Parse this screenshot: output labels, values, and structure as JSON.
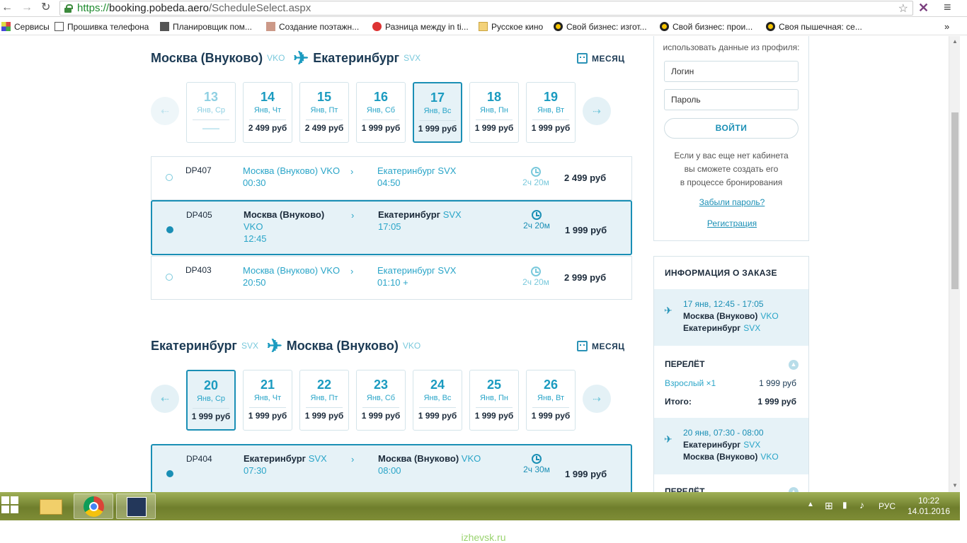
{
  "browser": {
    "url_scheme": "https://",
    "url_host": "booking.pobeda.aero",
    "url_path": "/ScheduleSelect.aspx",
    "back_icon": "arrow-left-icon",
    "forward_icon": "arrow-right-icon",
    "reload_icon": "reload-icon",
    "bookmarks": [
      {
        "label": "Сервисы",
        "icon": "apps-icon"
      },
      {
        "label": "Прошивка телефона",
        "icon": "page-icon"
      },
      {
        "label": "Планировщик пом...",
        "icon": "5d-icon"
      },
      {
        "label": "Создание поэтажн...",
        "icon": "draw-icon"
      },
      {
        "label": "Разница между in ti...",
        "icon": "apple-icon"
      },
      {
        "label": "Русское кино",
        "icon": "folder-icon"
      },
      {
        "label": "Свой бизнес: изгот...",
        "icon": "yellow-circle-icon"
      },
      {
        "label": "Свой бизнес: прои...",
        "icon": "yellow-circle-icon"
      },
      {
        "label": "Своя пышечная: се...",
        "icon": "yellow-circle-icon"
      }
    ],
    "more": "»"
  },
  "outbound": {
    "from_city": "Москва (Внуково)",
    "from_code": "VKO",
    "to_city": "Екатеринбург",
    "to_code": "SVX",
    "month_label": "МЕСЯЦ",
    "days": [
      {
        "num": "13",
        "label": "Янв, Ср",
        "price": "——"
      },
      {
        "num": "14",
        "label": "Янв, Чт",
        "price": "2 499 руб"
      },
      {
        "num": "15",
        "label": "Янв, Пт",
        "price": "2 499 руб"
      },
      {
        "num": "16",
        "label": "Янв, Сб",
        "price": "1 999 руб"
      },
      {
        "num": "17",
        "label": "Янв, Вс",
        "price": "1 999 руб"
      },
      {
        "num": "18",
        "label": "Янв, Пн",
        "price": "1 999 руб"
      },
      {
        "num": "19",
        "label": "Янв, Вт",
        "price": "1 999 руб"
      }
    ],
    "flights": [
      {
        "no": "DP407",
        "from": "Москва (Внуково)",
        "from_code": "VKO",
        "dep": "00:30",
        "to": "Екатеринбург",
        "to_code": "SVX",
        "arr": "04:50",
        "dur": "2ч 20м",
        "price": "2 499 руб"
      },
      {
        "no": "DP405",
        "from": "Москва (Внуково)",
        "from_code": "VKO",
        "dep": "12:45",
        "to": "Екатеринбург",
        "to_code": "SVX",
        "arr": "17:05",
        "dur": "2ч 20м",
        "price": "1 999 руб"
      },
      {
        "no": "DP403",
        "from": "Москва (Внуково)",
        "from_code": "VKO",
        "dep": "20:50",
        "to": "Екатеринбург",
        "to_code": "SVX",
        "arr": "01:10 +",
        "dur": "2ч 20м",
        "price": "2 999 руб"
      }
    ]
  },
  "inbound": {
    "from_city": "Екатеринбург",
    "from_code": "SVX",
    "to_city": "Москва (Внуково)",
    "to_code": "VKO",
    "month_label": "МЕСЯЦ",
    "days": [
      {
        "num": "20",
        "label": "Янв, Ср",
        "price": "1 999 руб"
      },
      {
        "num": "21",
        "label": "Янв, Чт",
        "price": "1 999 руб"
      },
      {
        "num": "22",
        "label": "Янв, Пт",
        "price": "1 999 руб"
      },
      {
        "num": "23",
        "label": "Янв, Сб",
        "price": "1 999 руб"
      },
      {
        "num": "24",
        "label": "Янв, Вс",
        "price": "1 999 руб"
      },
      {
        "num": "25",
        "label": "Янв, Пн",
        "price": "1 999 руб"
      },
      {
        "num": "26",
        "label": "Янв, Вт",
        "price": "1 999 руб"
      }
    ],
    "flights": [
      {
        "no": "DP404",
        "from": "Екатеринбург",
        "from_code": "SVX",
        "dep": "07:30",
        "to": "Москва (Внуково)",
        "to_code": "VKO",
        "arr": "08:00",
        "dur": "2ч 30м",
        "price": "1 999 руб"
      }
    ]
  },
  "login": {
    "hint": "использовать данные из профиля:",
    "login_placeholder": "Логин",
    "password_placeholder": "Пароль",
    "submit": "ВОЙТИ",
    "no_cabinet_1": "Если у вас еще нет кабинета",
    "no_cabinet_2": "вы сможете создать его",
    "no_cabinet_3": "в процессе бронирования",
    "forgot": "Забыли пароль?",
    "register": "Регистрация"
  },
  "order": {
    "title": "ИНФОРМАЦИЯ О ЗАКАЗЕ",
    "seg1": {
      "time": "17 янв, 12:45 - 17:05",
      "from": "Москва (Внуково)",
      "from_code": "VKO",
      "to": "Екатеринбург",
      "to_code": "SVX"
    },
    "flight_label": "ПЕРЕЛЁТ",
    "adult": "Взрослый ×1",
    "adult_price": "1 999  руб",
    "total_label": "Итого:",
    "total": "1 999  руб",
    "seg2": {
      "time": "20 янв, 07:30 - 08:00",
      "from": "Екатеринбург",
      "from_code": "SVX",
      "to": "Москва (Внуково)",
      "to_code": "VKO"
    },
    "flight_label2": "ПЕРЕЛЁТ"
  },
  "taskbar": {
    "lang": "РУС",
    "time": "10:22",
    "date": "14.01.2016"
  },
  "watermark": "izhevsk.ru"
}
